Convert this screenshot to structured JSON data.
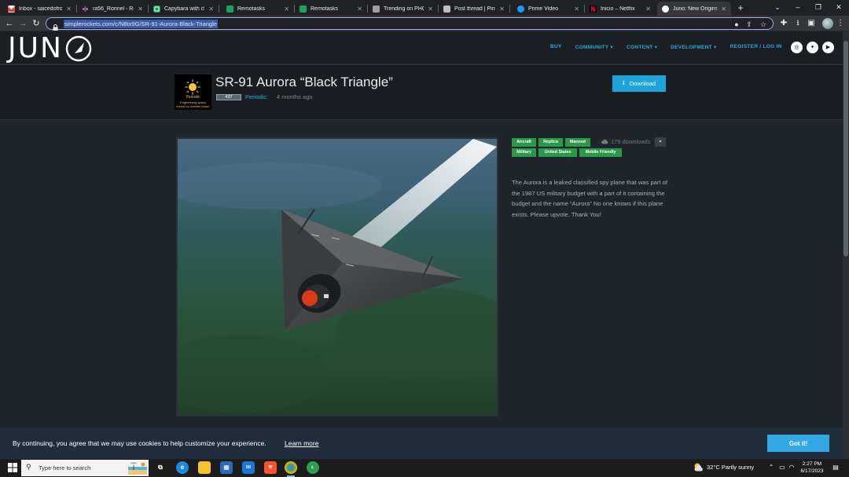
{
  "browser": {
    "tabs": [
      {
        "title": "Inbox - saicedofro",
        "icon": "gmail-icon",
        "color": "#ea4335"
      },
      {
        "title": "ra56_Ronnel - Rem",
        "icon": "slack-icon",
        "color": "#e01e5a"
      },
      {
        "title": "Capybara with cha",
        "icon": "sheets-icon",
        "color": "#0f9d58"
      },
      {
        "title": "Remotasks",
        "icon": "remotasks-icon",
        "color": "#1aa260"
      },
      {
        "title": "Remotasks",
        "icon": "remotasks-icon",
        "color": "#1aa260"
      },
      {
        "title": "Trending on PHCo",
        "icon": "phcorner-icon",
        "color": "#9e9e9e"
      },
      {
        "title": "Post thread | Pinoy",
        "icon": "document-icon",
        "color": "#bdbdbd"
      },
      {
        "title": "Prime Video",
        "icon": "prime-video-icon",
        "color": "#1a98ff"
      },
      {
        "title": "Inicio – Netflix",
        "icon": "netflix-icon",
        "color": "#e50914"
      },
      {
        "title": "Juno: New Origins",
        "icon": "juno-icon",
        "color": "#ffffff",
        "active": true
      }
    ],
    "url": "simplerockets.com/c/N8tx9G/SR-91-Aurora-Black-Triangle"
  },
  "site": {
    "logo": "JUN",
    "nav": [
      "BUY",
      "COMMUNITY ▾",
      "CONTENT ▾",
      "DEVELOPMENT ▾",
      "REGISTER / LOG IN"
    ],
    "social": [
      {
        "icon": "instagram-icon",
        "glyph": "◎"
      },
      {
        "icon": "twitter-icon",
        "glyph": "✦"
      },
      {
        "icon": "youtube-icon",
        "glyph": "▶"
      }
    ],
    "accent": "#2aa8df"
  },
  "craft": {
    "title": "SR-91 Aurora “Black Triangle”",
    "avatar_lines": [
      "Periodic",
      "Engineering spacy",
      "fueled by a better future"
    ],
    "rating": "437",
    "author": "Periodic",
    "posted": "4 months ago",
    "download_label": "Download",
    "downloads": "179 downloads",
    "tags": [
      "Aircraft",
      "Replica",
      "Manned",
      "Military",
      "United States",
      "Mobile Friendly"
    ],
    "tag_color": "#2a9a4a",
    "description": "The Aurora is a leaked classified spy plane that was part of the 1987 US military budget with a part of it containing the budget and the name “Aurora” No one knows if this plane exists. Please upvote. Thank You!"
  },
  "cookie": {
    "text": "By continuing, you agree that we may use cookies to help customize your experience.",
    "link": "Learn more",
    "button": "Got it!"
  },
  "taskbar": {
    "search_placeholder": "Type here to search",
    "weather": "32°C  Partly sunny",
    "time": "2:27 PM",
    "date": "6/17/2023"
  }
}
